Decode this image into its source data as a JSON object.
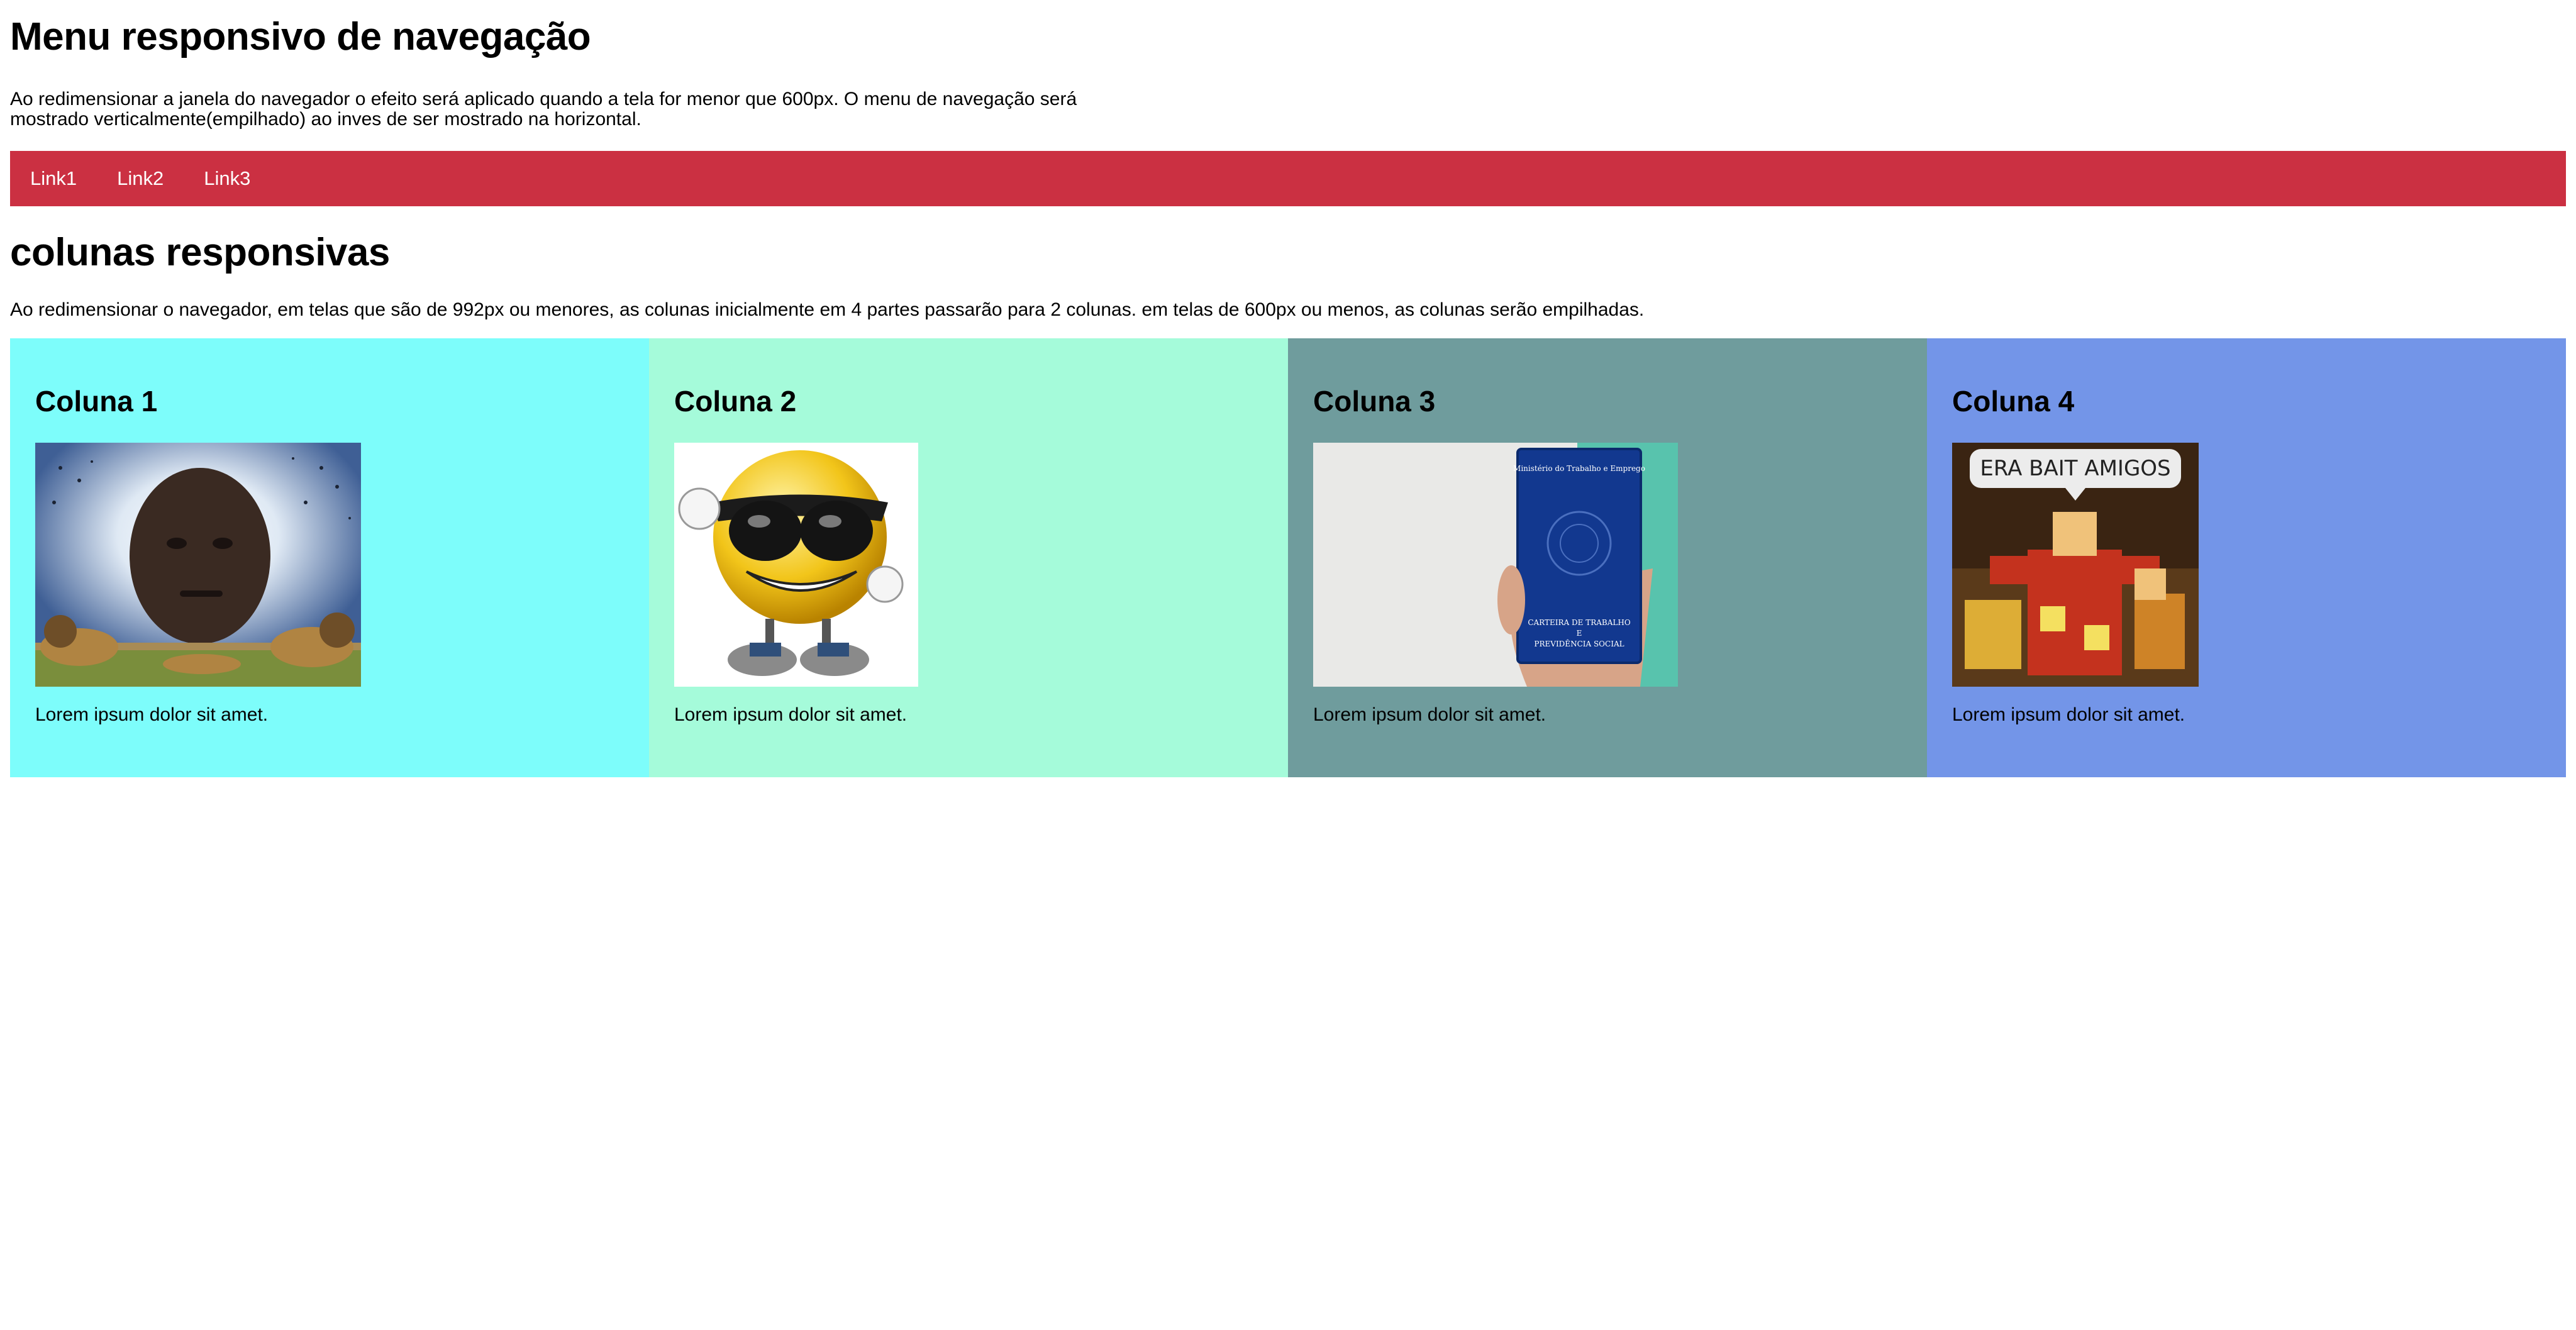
{
  "header": {
    "title": "Menu responsivo de navegação",
    "intro": "Ao redimensionar a janela do navegador o efeito será aplicado quando a tela for menor que 600px. O menu de navegação será mostrado verticalmente(empilhado) ao inves de ser mostrado na horizontal."
  },
  "nav": {
    "color": "#cb3042",
    "links": [
      {
        "label": "Link1"
      },
      {
        "label": "Link2"
      },
      {
        "label": "Link3"
      }
    ]
  },
  "section": {
    "title": "colunas responsivas",
    "description": "Ao redimensionar o navegador, em telas que são de 992px ou menores, as colunas inicialmente em 4 partes passarão para 2 colunas. em telas de 600px ou menos, as colunas serão empilhadas."
  },
  "columns": [
    {
      "title": "Coluna 1",
      "text": "Lorem ipsum dolor sit amet.",
      "color": "#7dfdfb",
      "image": "man-face-with-lions-image"
    },
    {
      "title": "Coluna 2",
      "text": "Lorem ipsum dolor sit amet.",
      "color": "#a5fbda",
      "image": "smiley-sunglasses-thumbs-up-image"
    },
    {
      "title": "Coluna 3",
      "text": "Lorem ipsum dolor sit amet.",
      "color": "#6f9c9d",
      "image": "hand-holding-work-booklet-image"
    },
    {
      "title": "Coluna 4",
      "text": "Lorem ipsum dolor sit amet.",
      "color": "#7395e8",
      "image": "era-bait-amigos-meme-image"
    }
  ],
  "images": {
    "booklet_title": "Ministério do Trabalho e Emprego",
    "booklet_line1": "CARTEIRA DE TRABALHO",
    "booklet_line2": "E",
    "booklet_line3": "PREVIDÊNCIA SOCIAL",
    "meme_caption": "ERA BAIT AMIGOS"
  }
}
